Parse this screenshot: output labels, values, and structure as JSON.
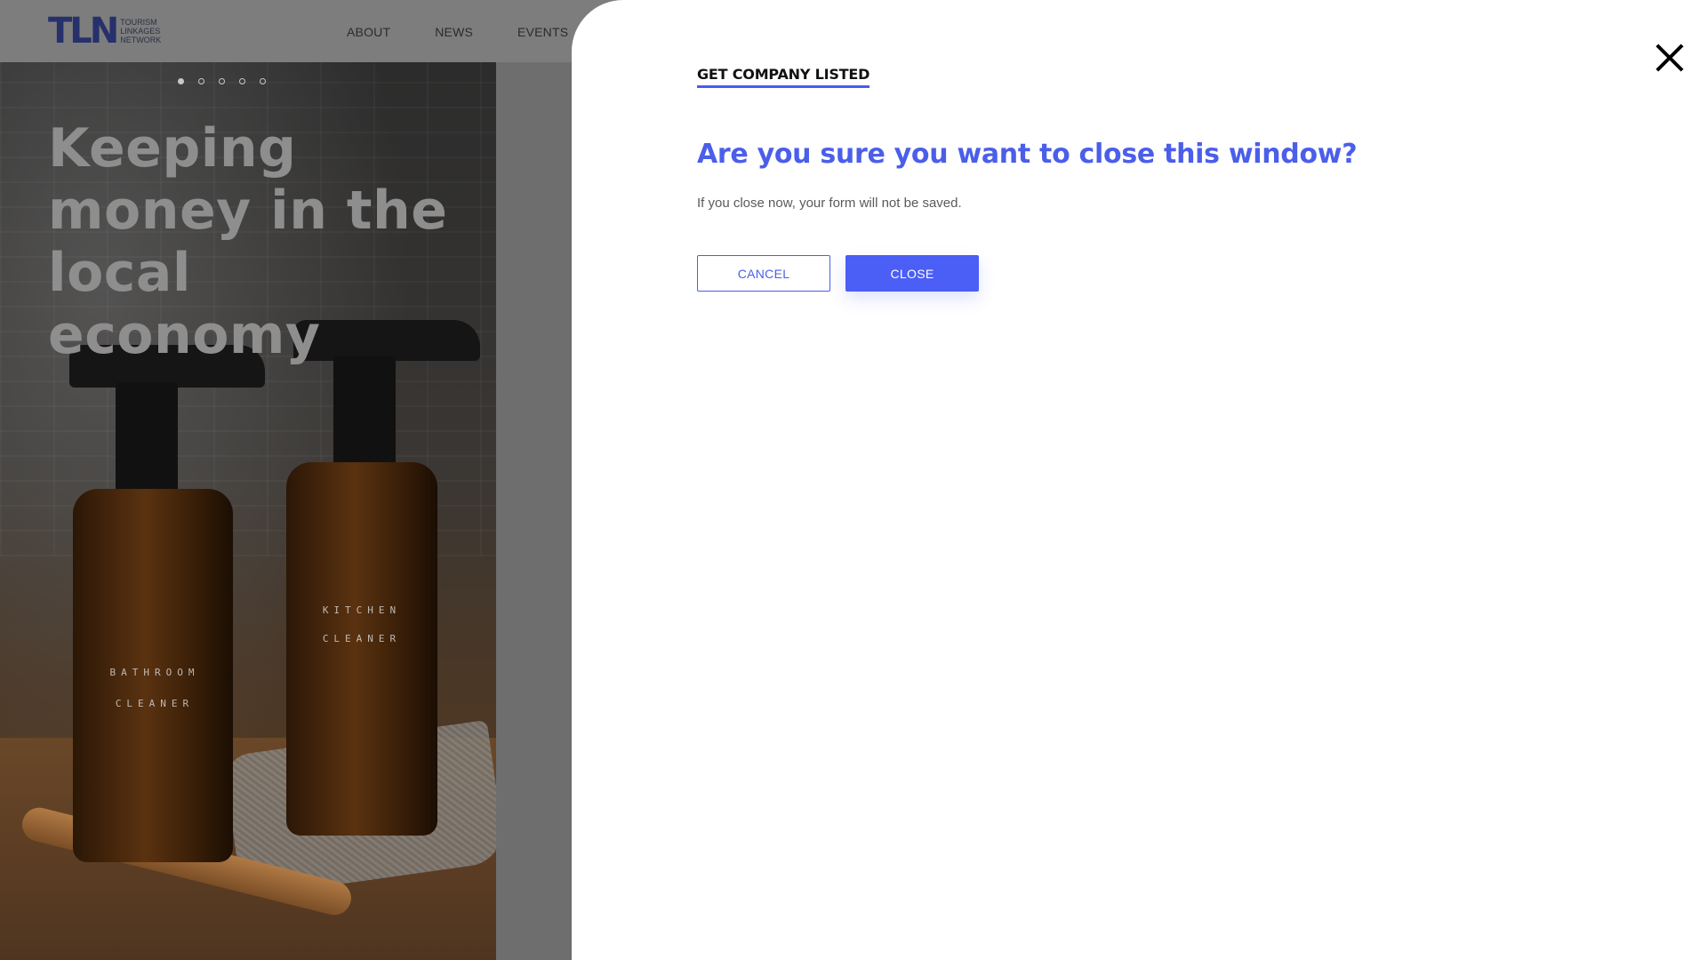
{
  "site": {
    "logo_mark": "TLN",
    "logo_lines": [
      "TOURISM",
      "LINKAGES",
      "NETWORK"
    ],
    "nav": [
      "ABOUT",
      "NEWS",
      "EVENTS"
    ]
  },
  "hero": {
    "title": "Keeping money in the local economy",
    "slide_count": 5,
    "active_slide": 1,
    "bottle_labels": [
      {
        "line1": "BATHROOM",
        "line2": "CLEANER"
      },
      {
        "line1": "KITCHEN",
        "line2": "CLEANER"
      }
    ]
  },
  "modal": {
    "heading": "GET COMPANY LISTED",
    "title": "Are you sure you want to close this window?",
    "message": "If you close now, your form will not be saved.",
    "cancel_label": "CANCEL",
    "close_label": "CLOSE",
    "close_icon": "close-icon"
  },
  "colors": {
    "accent": "#4b5ef5",
    "title": "#4b5eea",
    "logo": "#26306b"
  }
}
